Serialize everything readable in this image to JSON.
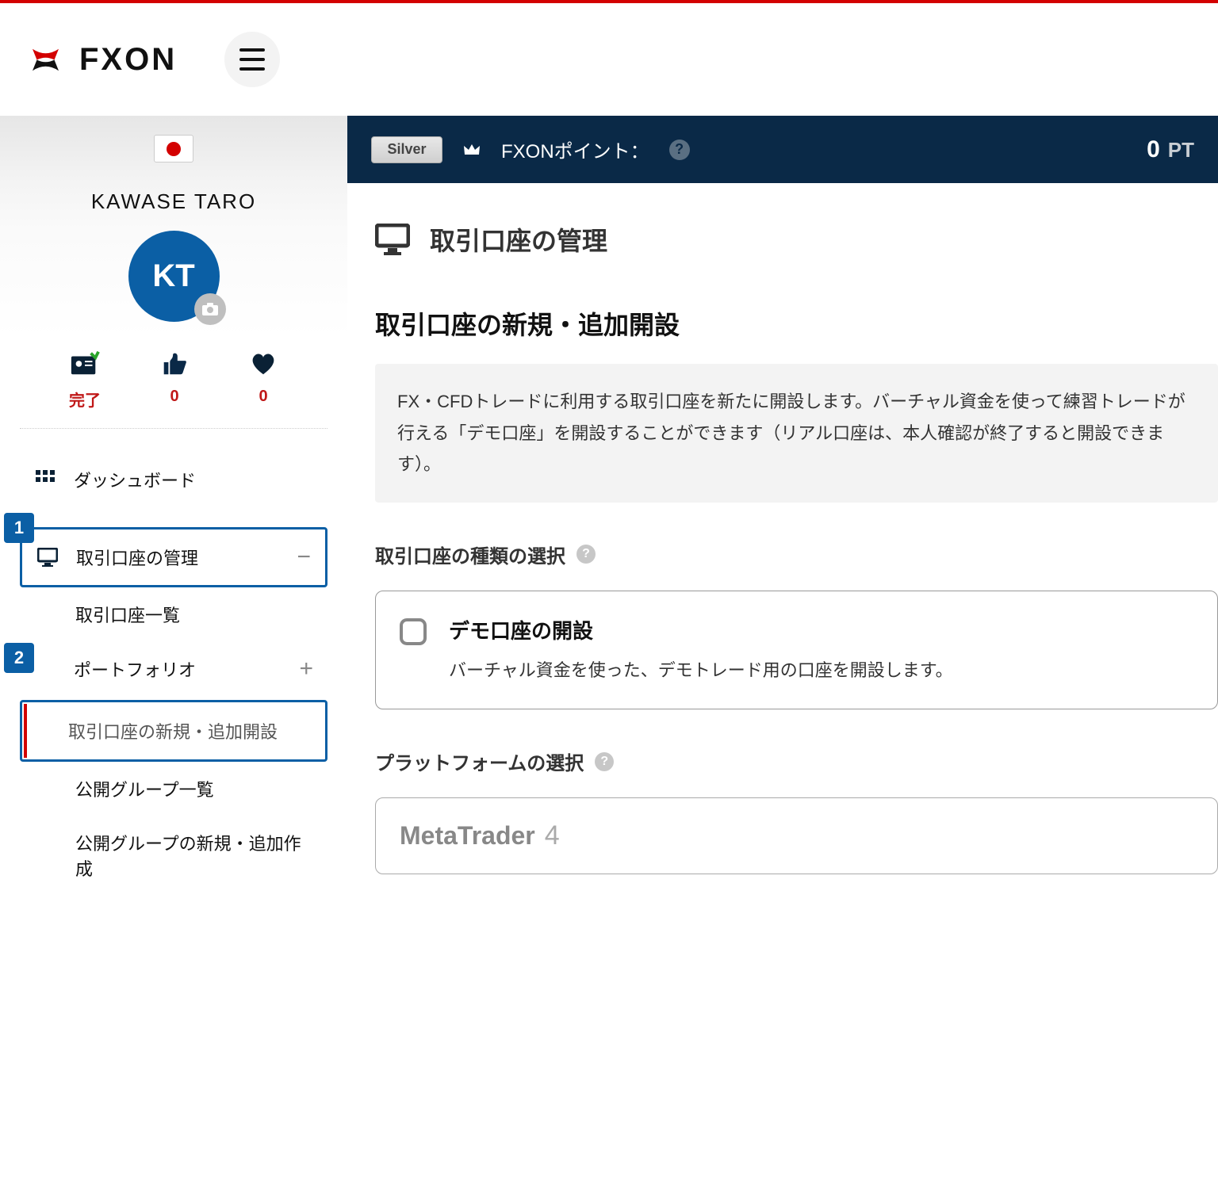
{
  "header": {
    "brand": "FXON"
  },
  "user": {
    "name": "KAWASE TARO",
    "initials": "KT"
  },
  "stats": {
    "verify": "完了",
    "likes": "0",
    "favs": "0"
  },
  "nav": {
    "dashboard": "ダッシュボード",
    "accounts_mgmt": "取引口座の管理",
    "accounts_list": "取引口座一覧",
    "portfolio": "ポートフォリオ",
    "new_account": "取引口座の新規・追加開設",
    "public_groups": "公開グループ一覧",
    "public_groups_new": "公開グループの新規・追加作成"
  },
  "topbar": {
    "tier": "Silver",
    "point_label": "FXONポイント：",
    "points": "0",
    "unit": "PT"
  },
  "page": {
    "title": "取引口座の管理",
    "h2": "取引口座の新規・追加開設",
    "notice": "FX・CFDトレードに利用する取引口座を新たに開設します。バーチャル資金を使って練習トレードが行える「デモ口座」を開設することができます（リアル口座は、本人確認が終了すると開設できます）。",
    "type_head": "取引口座の種類の選択",
    "demo_title": "デモ口座の開設",
    "demo_desc": "バーチャル資金を使った、デモトレード用の口座を開設します。",
    "platform_head": "プラットフォームの選択",
    "mt_name": "MetaTrader",
    "mt_num": "4"
  }
}
